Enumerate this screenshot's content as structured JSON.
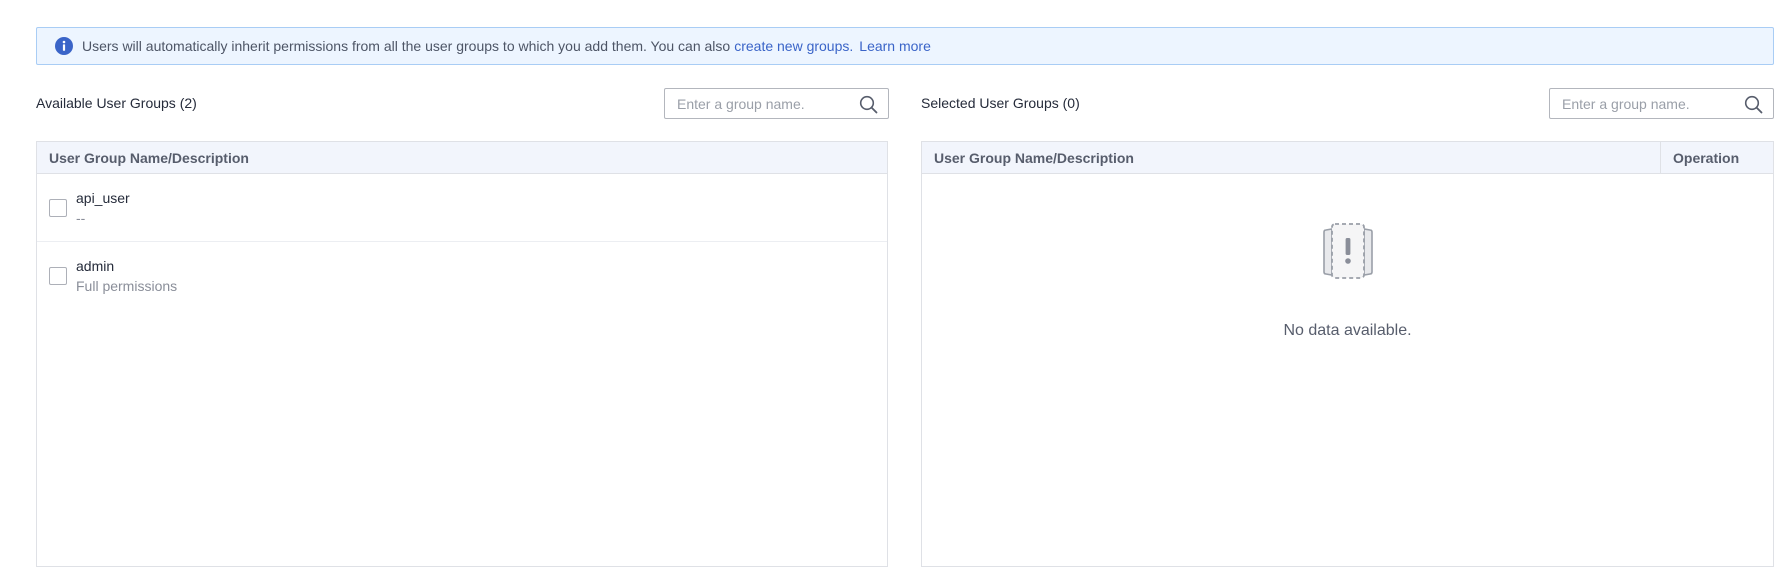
{
  "banner": {
    "text": "Users will automatically inherit permissions from all the user groups to which you add them. You can also",
    "link_create": "create new groups.",
    "link_learn": "Learn more"
  },
  "available": {
    "title": "Available User Groups (2)",
    "search_placeholder": "Enter a group name.",
    "column_header": "User Group Name/Description",
    "rows": [
      {
        "name": "api_user",
        "description": "--"
      },
      {
        "name": "admin",
        "description": "Full permissions"
      }
    ]
  },
  "selected": {
    "title": "Selected User Groups (0)",
    "search_placeholder": "Enter a group name.",
    "column_header": "User Group Name/Description",
    "operation_header": "Operation",
    "empty_text": "No data available."
  },
  "icons": {
    "info": "info-icon",
    "search": "search-icon",
    "empty": "empty-data-icon"
  },
  "colors": {
    "banner_bg": "#edf5ff",
    "banner_border": "#a9cdf5",
    "info_icon": "#3a64c8",
    "link": "#3a64c8",
    "table_header_bg": "#f2f5fc"
  }
}
